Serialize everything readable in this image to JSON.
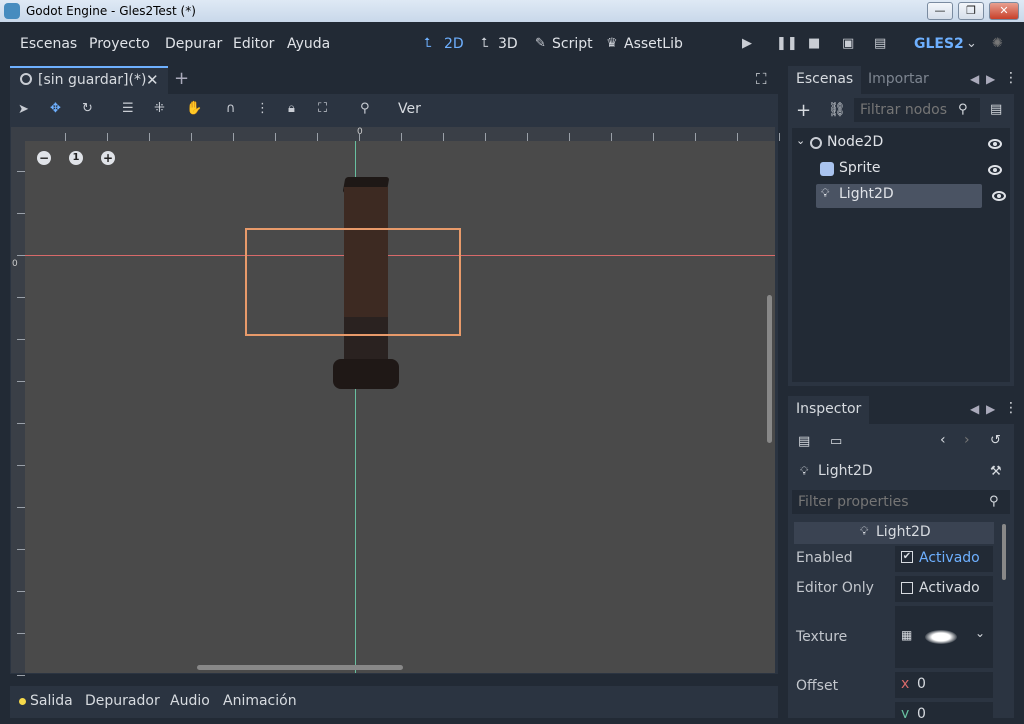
{
  "window": {
    "title": "Godot Engine - Gles2Test (*)",
    "min": "—",
    "max": "❐",
    "close": "✕"
  },
  "menu": {
    "items": [
      "Escenas",
      "Proyecto",
      "Depurar",
      "Editor",
      "Ayuda"
    ]
  },
  "modes": {
    "m2d": "2D",
    "m3d": "3D",
    "script": "Script",
    "assetlib": "AssetLib"
  },
  "renderer": {
    "label": "GLES2"
  },
  "editor_tab": {
    "label": "[sin guardar](*)"
  },
  "toolbar": {
    "view_label": "Ver"
  },
  "viewport": {
    "ruler_zero_x": "0",
    "ruler_zero_y": "0",
    "zoom_reset": "1"
  },
  "bottom": {
    "tabs": [
      "Salida",
      "Depurador",
      "Audio",
      "Animación"
    ]
  },
  "scene_panel": {
    "tab_active": "Escenas",
    "tab_other": "Importar",
    "filter_placeholder": "Filtrar nodos",
    "tree": [
      {
        "label": "Node2D"
      },
      {
        "label": "Sprite"
      },
      {
        "label": "Light2D"
      }
    ]
  },
  "inspector": {
    "tab": "Inspector",
    "node_name": "Light2D",
    "filter_placeholder": "Filter properties",
    "section": "Light2D",
    "props": {
      "enabled_label": "Enabled",
      "enabled_value": "Activado",
      "editor_only_label": "Editor Only",
      "editor_only_value": "Activado",
      "texture_label": "Texture",
      "offset_label": "Offset",
      "offset_x_axis": "x",
      "offset_x": "0",
      "offset_y_axis": "y",
      "offset_y": "0"
    }
  },
  "colors": {
    "accent": "#6eb0ff",
    "bg": "#222a35",
    "panel": "#2b3441",
    "light_box": "#e89a6a"
  }
}
